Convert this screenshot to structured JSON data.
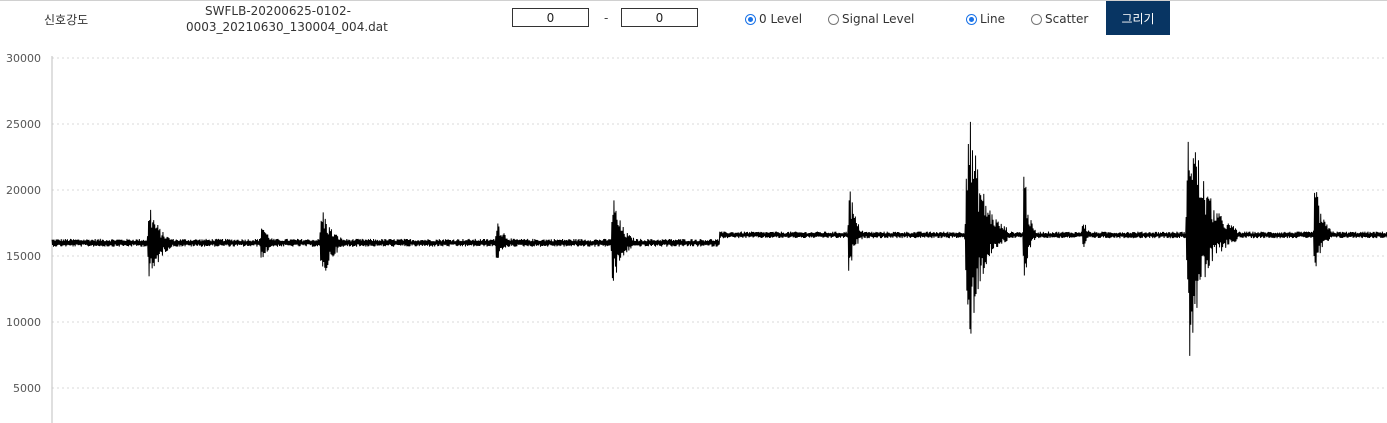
{
  "header": {
    "title": "신호강도",
    "filename_line1": "SWFLB-20200625-0102-",
    "filename_line2": "0003_20210630_130004_004.dat",
    "range_from": "0",
    "range_sep": "-",
    "range_to": "0",
    "level_options": [
      "0 Level",
      "Signal Level"
    ],
    "level_selected": "0 Level",
    "style_options": [
      "Line",
      "Scatter"
    ],
    "style_selected": "Line",
    "draw_button": "그리기"
  },
  "chart_data": {
    "type": "line",
    "title": "",
    "xlabel": "",
    "ylabel": "",
    "ylim": [
      3000,
      30000
    ],
    "yticks": [
      5000,
      10000,
      15000,
      20000,
      25000,
      30000
    ],
    "grid": true,
    "series": [
      {
        "color": "#000000",
        "baselines": [
          {
            "x_from": 0,
            "x_to": 0.5,
            "level": 16000,
            "noise": 300
          },
          {
            "x_from": 0.5,
            "x_to": 1,
            "level": 16600,
            "noise": 250
          }
        ],
        "bursts": [
          {
            "x": 0.073,
            "width": 0.022,
            "max": 19300,
            "min": 12200
          },
          {
            "x": 0.157,
            "width": 0.014,
            "max": 18000,
            "min": 14200
          },
          {
            "x": 0.202,
            "width": 0.022,
            "max": 19000,
            "min": 12400
          },
          {
            "x": 0.333,
            "width": 0.018,
            "max": 18200,
            "min": 14500
          },
          {
            "x": 0.42,
            "width": 0.02,
            "max": 20000,
            "min": 12200
          },
          {
            "x": 0.597,
            "width": 0.012,
            "max": 21500,
            "min": 12700
          },
          {
            "x": 0.686,
            "width": 0.03,
            "max": 27500,
            "min": 6800
          },
          {
            "x": 0.728,
            "width": 0.009,
            "max": 23300,
            "min": 11000
          },
          {
            "x": 0.772,
            "width": 0.008,
            "max": 18500,
            "min": 14800
          },
          {
            "x": 0.852,
            "width": 0.036,
            "max": 27200,
            "min": 7000
          },
          {
            "x": 0.946,
            "width": 0.016,
            "max": 20900,
            "min": 13100
          }
        ]
      }
    ]
  }
}
